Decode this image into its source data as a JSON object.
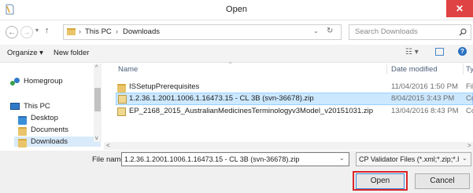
{
  "window": {
    "title": "Open",
    "close_glyph": "✕"
  },
  "address": {
    "path": [
      "This PC",
      "Downloads"
    ],
    "search_placeholder": "Search Downloads"
  },
  "toolbar": {
    "organize_label": "Organize ▾",
    "new_folder_label": "New folder"
  },
  "nav": {
    "items": [
      {
        "label": "Homegroup",
        "icon": "homegroup-icon"
      },
      {
        "label": "This PC",
        "icon": "computer-icon"
      },
      {
        "label": "Desktop",
        "icon": "folder-icon"
      },
      {
        "label": "Documents",
        "icon": "folder-icon"
      },
      {
        "label": "Downloads",
        "icon": "download-folder-icon"
      }
    ]
  },
  "columns": {
    "name": "Name",
    "date": "Date modified",
    "type": "Ty"
  },
  "files": [
    {
      "name": "ISSetupPrerequisites",
      "date": "11/04/2016 1:50 PM",
      "type": "Fil",
      "icon": "folder-icon",
      "selected": false
    },
    {
      "name": "1.2.36.1.2001.1006.1.16473.15 - CL 3B (svn-36678).zip",
      "date": "8/04/2015 3:43 PM",
      "type": "Co",
      "icon": "zip-icon",
      "selected": true
    },
    {
      "name": "EP_2168_2015_AustralianMedicinesTerminologyv3Model_v20151031.zip",
      "date": "13/04/2016 8:43 PM",
      "type": "Co",
      "icon": "zip-icon",
      "selected": false
    }
  ],
  "footer": {
    "filename_label": "File name:",
    "filename_value": "1.2.36.1.2001.1006.1.16473.15 - CL 3B (svn-36678).zip",
    "filter_value": "CP Validator Files (*.xml;*.zip;*.l",
    "open_label": "Open",
    "cancel_label": "Cancel"
  },
  "colors": {
    "selection": "#cce8ff",
    "highlight_box": "#d9252a",
    "close": "#e04343"
  }
}
